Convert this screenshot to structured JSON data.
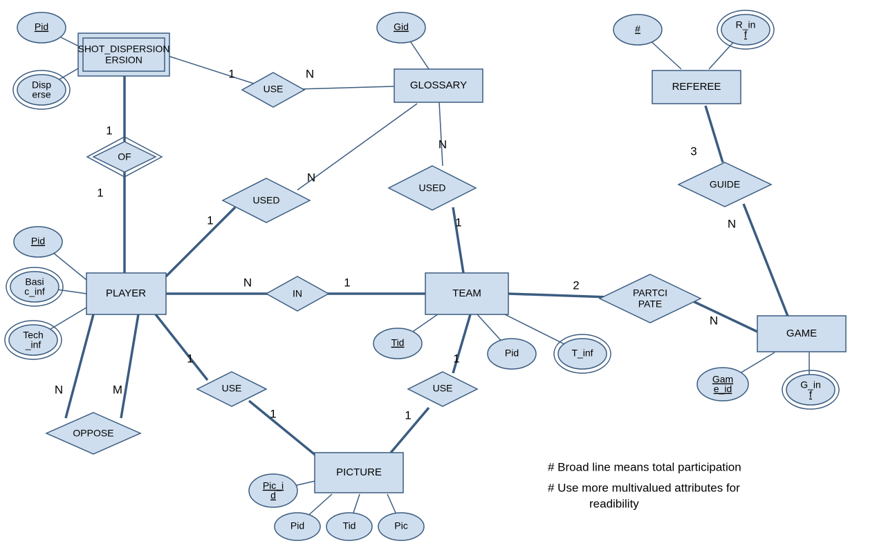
{
  "entities": {
    "shot_dispersion": "SHOT_DISPERSION",
    "glossary": "GLOSSARY",
    "referee": "REFEREE",
    "player": "PLAYER",
    "team": "TEAM",
    "game": "GAME",
    "picture": "PICTURE"
  },
  "relationships": {
    "use_sd_gl": "USE",
    "of": "OF",
    "used_pl_gl": "USED",
    "used_tm_gl": "USED",
    "in": "IN",
    "participate": "PARTCIPATE",
    "guide": "GUIDE",
    "oppose": "OPPOSE",
    "use_pl_pic": "USE",
    "use_tm_pic": "USE"
  },
  "attributes": {
    "sd_pid": "Pid",
    "sd_disperse": "Disperse",
    "gl_gid": "Gid",
    "ref_num": "#",
    "ref_rinf": "R_inf",
    "pl_pid": "Pid",
    "pl_basicinf": "Basic_inf",
    "pl_techinf": "Tech_inf",
    "tm_tid": "Tid",
    "tm_pid": "Pid",
    "tm_tinf": "T_inf",
    "gm_gameid": "Game_id",
    "gm_ginf": "G_inf",
    "pic_picid": "Pic_id",
    "pic_pid": "Pid",
    "pic_tid": "Tid",
    "pic_pic": "Pic"
  },
  "card": {
    "use_sd": "1",
    "use_gl": "N",
    "of_sd": "1",
    "of_pl": "1",
    "used_pl": "1",
    "used_pl_gl": "N",
    "used_tm": "1",
    "used_tm_gl": "N",
    "in_pl": "N",
    "in_tm": "1",
    "part_tm": "2",
    "part_gm": "N",
    "guide_ref": "3",
    "guide_gm": "N",
    "oppose_l": "N",
    "oppose_r": "M",
    "use_pl_pic_u": "1",
    "use_pl_pic_d": "1",
    "use_tm_pic_u": "1",
    "use_tm_pic_d": "1"
  },
  "notes": {
    "n1": "# Broad line means  total participation",
    "n2": "# Use more multivalued attributes for",
    "n3": "readibility"
  }
}
